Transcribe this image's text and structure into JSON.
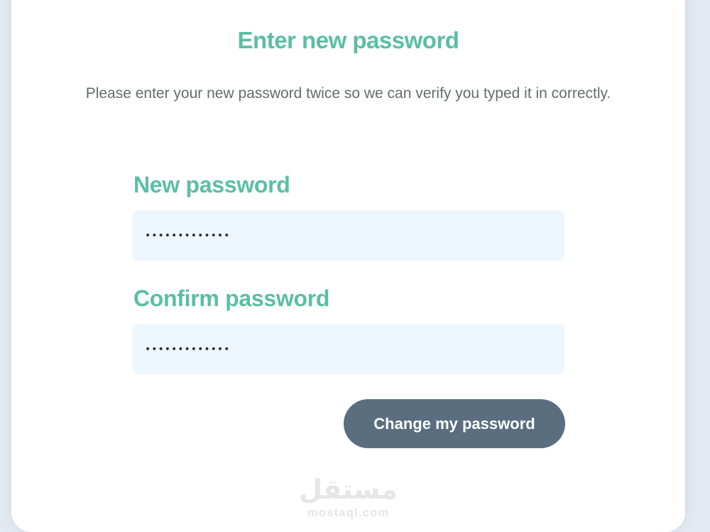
{
  "colors": {
    "accent": "#5bbea5",
    "page_background": "#e3eaf2",
    "card_background": "#ffffff",
    "input_background": "#eef6fe",
    "button_background": "#5a6e7f",
    "body_text": "#666b70"
  },
  "form": {
    "title": "Enter new password",
    "subtitle": "Please enter your new password twice so we can verify you typed it in correctly.",
    "new_password": {
      "label": "New password",
      "value": "•••••••••••••"
    },
    "confirm_password": {
      "label": "Confirm password",
      "value": "•••••••••••••"
    },
    "submit_label": "Change my password"
  },
  "watermark": {
    "logo_text": "مستقل",
    "domain": "mostaql.com"
  }
}
